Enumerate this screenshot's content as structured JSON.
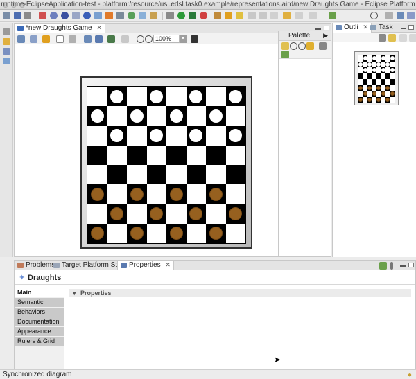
{
  "window": {
    "title": "runtime-EclipseApplication-test - platform:/resource/usi.edsl.task0.example/representations.aird/new Draughts Game - Eclipse Platform"
  },
  "editor": {
    "tab_label": "*new Draughts Game",
    "zoom": "100%"
  },
  "palette": {
    "title": "Palette"
  },
  "outline": {
    "tabs": [
      "Outli",
      "Task"
    ]
  },
  "board": {
    "rows": [
      [
        "",
        "W",
        "",
        "W",
        "",
        "W",
        "",
        "W"
      ],
      [
        "W",
        "",
        "W",
        "",
        "W",
        "",
        "W",
        ""
      ],
      [
        "",
        "W",
        "",
        "W",
        "",
        "W",
        "",
        "W"
      ],
      [
        "",
        "",
        "",
        "",
        "",
        "",
        "",
        ""
      ],
      [
        "",
        "",
        "",
        "",
        "",
        "",
        "",
        ""
      ],
      [
        "B",
        "",
        "B",
        "",
        "B",
        "",
        "B",
        ""
      ],
      [
        "",
        "B",
        "",
        "B",
        "",
        "B",
        "",
        "B"
      ],
      [
        "B",
        "",
        "B",
        "",
        "B",
        "",
        "B",
        ""
      ]
    ],
    "colors": {
      "white_piece": "#ffffff",
      "brown_piece": "#96601f",
      "dark_square": "#000000",
      "light_square": "#ffffff"
    }
  },
  "bottom": {
    "tabs": [
      "Problems",
      "Target Platform State",
      "Properties"
    ],
    "active_tab": "Properties",
    "properties_title": "Draughts",
    "categories": [
      "Main",
      "Semantic",
      "Behaviors",
      "Documentation",
      "Appearance",
      "Rulers & Grid"
    ],
    "active_category": "Main",
    "section_label": "Properties"
  },
  "status": {
    "text": "Synchronized diagram"
  }
}
